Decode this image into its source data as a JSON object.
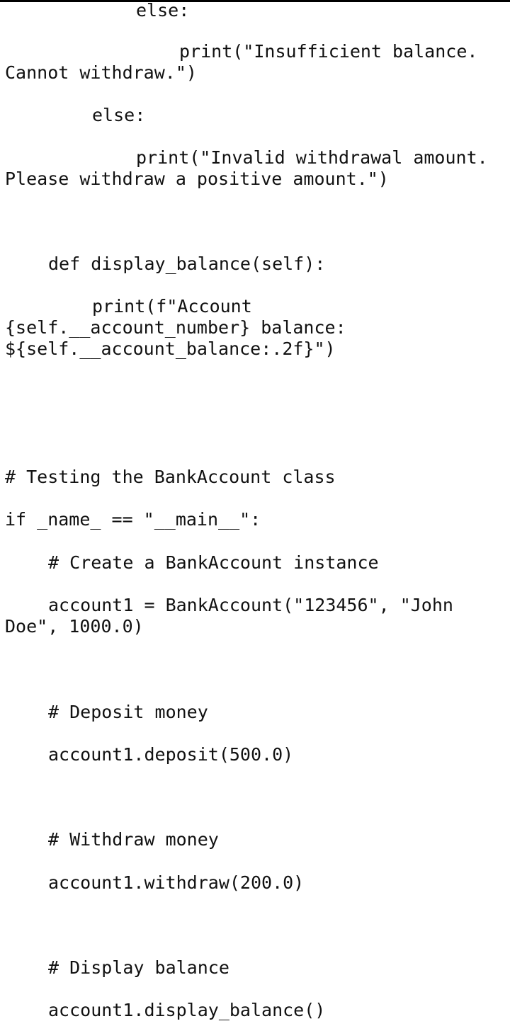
{
  "lines": [
    "else:",
    "print(\"Insufficient balance.",
    "Cannot withdraw.\")",
    "else:",
    "print(\"Invalid withdrawal amount.",
    "Please withdraw a positive amount.\")",
    "def display_balance(self):",
    "print(f\"Account",
    "{self.__account_number} balance:",
    "${self.__account_balance:.2f}\")",
    "# Testing the BankAccount class",
    "if _name_ == \"__main__\":",
    "# Create a BankAccount instance",
    "account1 = BankAccount(\"123456\", \"John",
    "Doe\", 1000.0)",
    "# Deposit money",
    "account1.deposit(500.0)",
    "# Withdraw money",
    "account1.withdraw(200.0)",
    "# Display balance",
    "account1.display_balance()"
  ]
}
